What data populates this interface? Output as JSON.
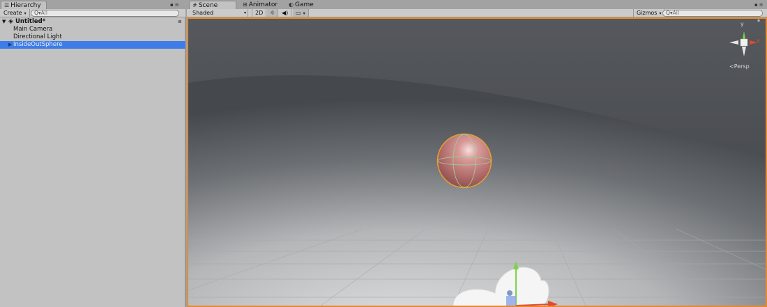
{
  "hierarchy": {
    "tab_label": "Hierarchy",
    "tab_icon": "list-icon",
    "create_label": "Create",
    "search_placeholder": "All",
    "scene_name": "Untitled*",
    "items": [
      {
        "label": "Main Camera",
        "selected": false
      },
      {
        "label": "Directional Light",
        "selected": false
      },
      {
        "label": "InsideOutSphere",
        "selected": true
      }
    ]
  },
  "tabs": [
    {
      "label": "Scene",
      "icon": "grid-icon",
      "active": true
    },
    {
      "label": "Animator",
      "icon": "animator-icon",
      "active": false
    },
    {
      "label": "Game",
      "icon": "pacman-icon",
      "active": false
    }
  ],
  "scene_toolbar": {
    "shading_mode": "Shaded",
    "mode_2d": "2D",
    "gizmos_label": "Gizmos",
    "search_placeholder": "All"
  },
  "viewport": {
    "projection_label": "Persp",
    "axis_y_label": "y",
    "axis_x_label": "x",
    "selection_color": "#e8a030",
    "sphere_color": "#c98080"
  },
  "colors": {
    "selection_blue": "#3e7de7",
    "viewport_border": "#e58a2e"
  }
}
